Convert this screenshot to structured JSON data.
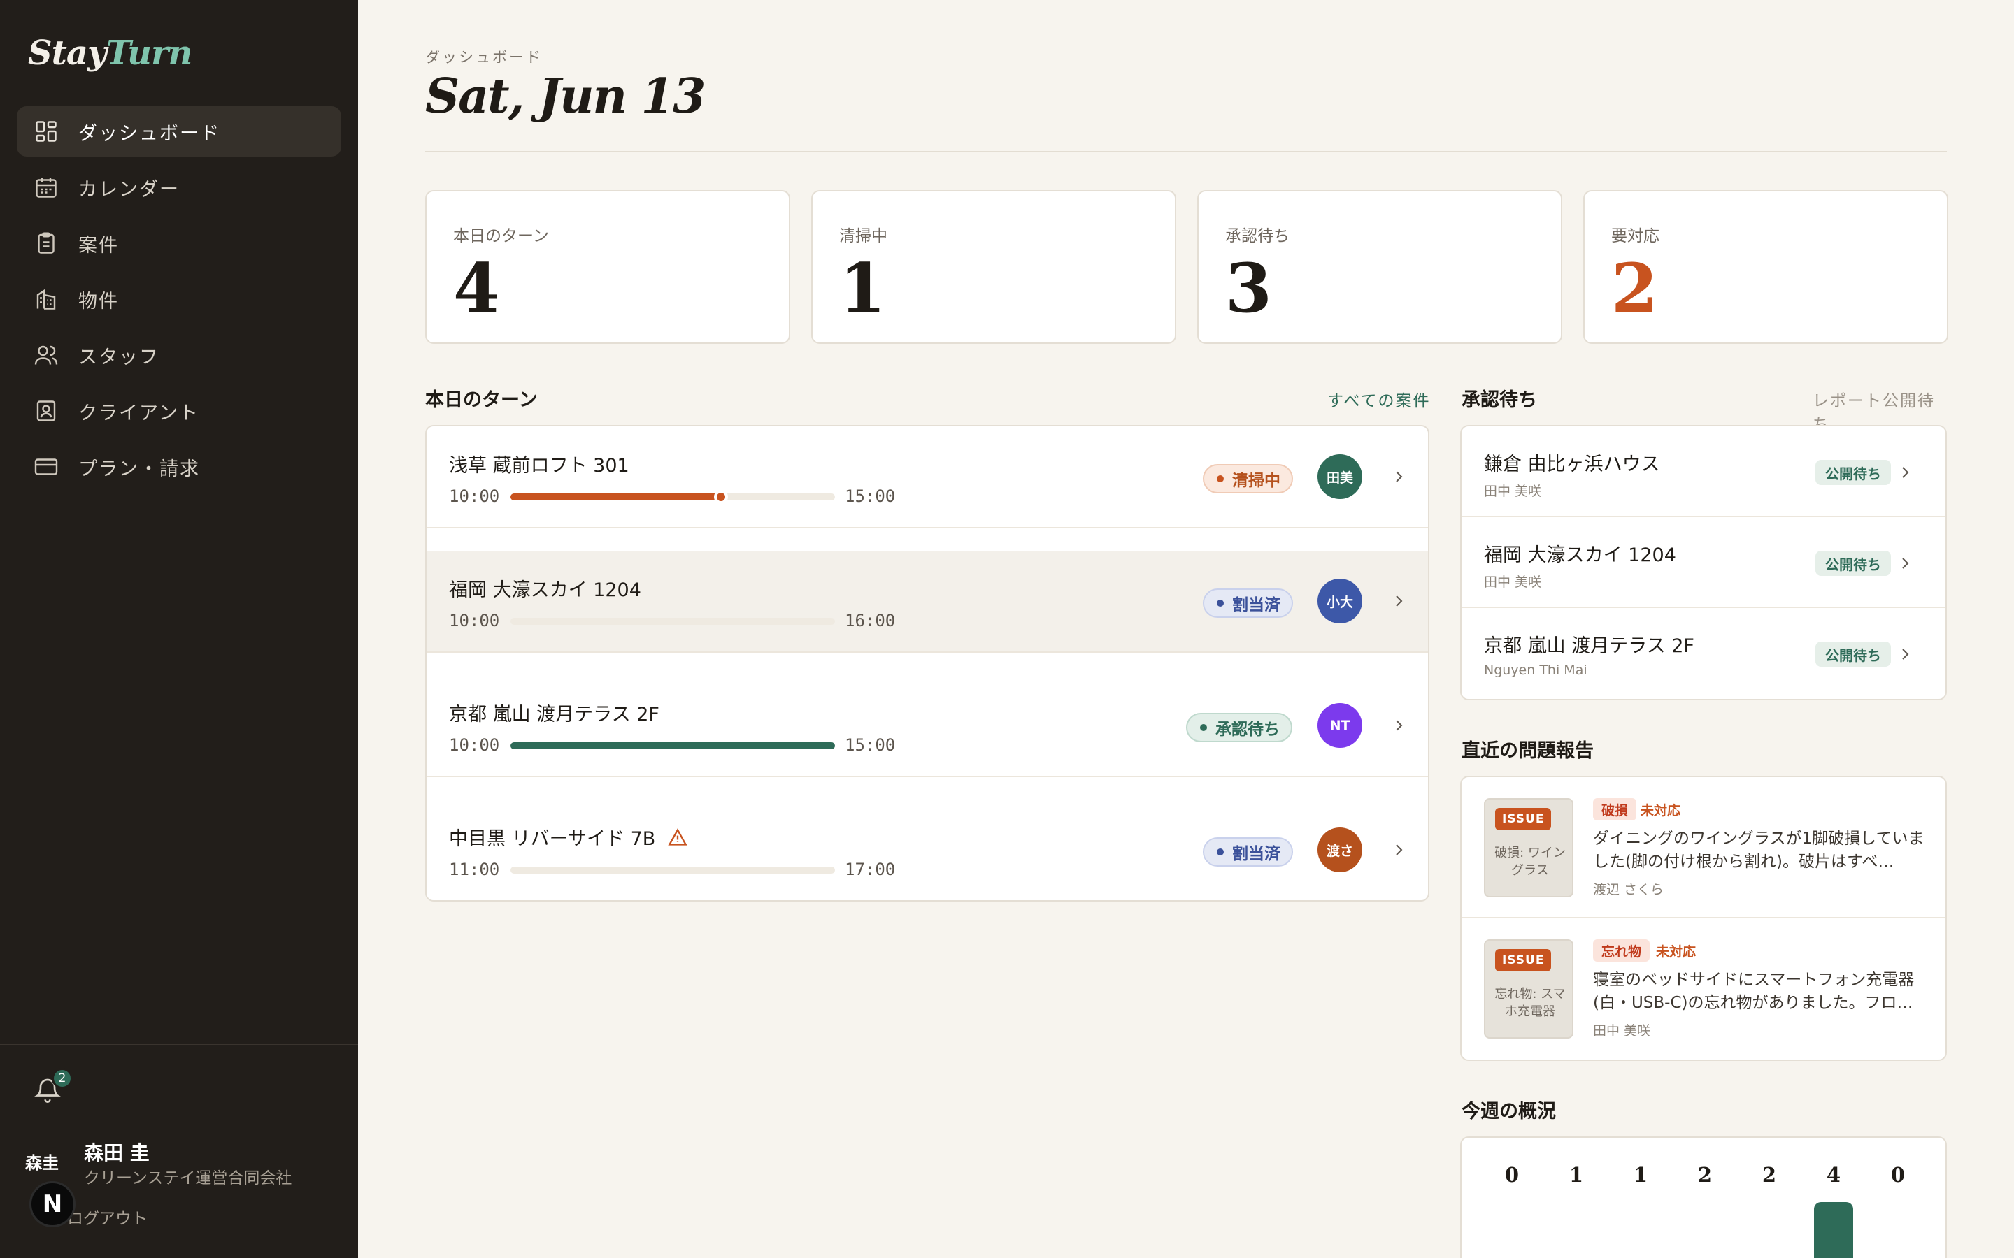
{
  "app": {
    "logo_part1": "Stay",
    "logo_part2": "Turn"
  },
  "sidebar": {
    "items": [
      {
        "label": "ダッシュボード",
        "icon": "dashboard-icon",
        "active": true
      },
      {
        "label": "カレンダー",
        "icon": "calendar-icon"
      },
      {
        "label": "案件",
        "icon": "clipboard-icon"
      },
      {
        "label": "物件",
        "icon": "building-icon"
      },
      {
        "label": "スタッフ",
        "icon": "users-icon"
      },
      {
        "label": "クライアント",
        "icon": "contact-icon"
      },
      {
        "label": "プラン・請求",
        "icon": "credit-card-icon"
      }
    ],
    "notifications": "2",
    "user": {
      "initials": "森圭",
      "name": "森田 圭",
      "org": "クリーンステイ運営合同会社",
      "logout": "ログアウト",
      "badge": "N"
    }
  },
  "header": {
    "kicker": "ダッシュボード",
    "date": "Sat, Jun 13"
  },
  "stats": [
    {
      "label": "本日のターン",
      "value": "4"
    },
    {
      "label": "清掃中",
      "value": "1"
    },
    {
      "label": "承認待ち",
      "value": "3"
    },
    {
      "label": "要対応",
      "value": "2",
      "alert": true
    }
  ],
  "turns_section": {
    "title": "本日のターン",
    "link": "すべての案件",
    "items": [
      {
        "name": "浅草 蔵前ロフト 301",
        "start": "10:00",
        "end": "15:00",
        "progress": 0.65,
        "status": "清掃中",
        "status_kind": "cleaning",
        "assignee": "田美",
        "assignee_color": "#2e6b58",
        "warning": false
      },
      {
        "name": "福岡 大濠スカイ 1204",
        "start": "10:00",
        "end": "16:00",
        "progress": 0,
        "status": "割当済",
        "status_kind": "assigned",
        "assignee": "小大",
        "assignee_color": "#3d58a8",
        "warning": false
      },
      {
        "name": "京都 嵐山 渡月テラス 2F",
        "start": "10:00",
        "end": "15:00",
        "progress": 1,
        "status": "承認待ち",
        "status_kind": "approval",
        "assignee": "NT",
        "assignee_color": "#7c3aed",
        "warning": false
      },
      {
        "name": "中目黒 リバーサイド 7B",
        "start": "11:00",
        "end": "17:00",
        "progress": 0,
        "status": "割当済",
        "status_kind": "assigned",
        "assignee": "渡さ",
        "assignee_color": "#b5511d",
        "warning": true
      }
    ]
  },
  "approvals_section": {
    "title": "承認待ち",
    "link": "レポート公開待ち",
    "items": [
      {
        "name": "鎌倉 由比ヶ浜ハウス",
        "staff": "田中 美咲",
        "tag": "公開待ち"
      },
      {
        "name": "福岡 大濠スカイ 1204",
        "staff": "田中 美咲",
        "tag": "公開待ち"
      },
      {
        "name": "京都 嵐山 渡月テラス 2F",
        "staff": "Nguyen Thi Mai",
        "tag": "公開待ち"
      }
    ]
  },
  "issues_section": {
    "title": "直近の問題報告",
    "items": [
      {
        "badge": "ISSUE",
        "thumb_text": "破損: ワイングラス",
        "category": "破損",
        "status": "未対応",
        "desc": "ダイニングのワイングラスが1脚破損していました(脚の付け根から割れ)。破片はすべ…",
        "reporter": "渡辺 さくら"
      },
      {
        "badge": "ISSUE",
        "thumb_text": "忘れ物: スマホ充電器",
        "category": "忘れ物",
        "status": "未対応",
        "desc": "寝室のベッドサイドにスマートフォン充電器(白・USB-C)の忘れ物がありました。フロ…",
        "reporter": "田中 美咲"
      }
    ]
  },
  "week_section": {
    "title": "今週の概況",
    "counts": [
      "0",
      "1",
      "1",
      "2",
      "2",
      "4",
      "0"
    ],
    "values": [
      0,
      1,
      1,
      2,
      2,
      4,
      0
    ],
    "highlight_index": 5,
    "colors": {
      "bar": "#d9d3c8",
      "highlight": "#2e6b58"
    }
  }
}
